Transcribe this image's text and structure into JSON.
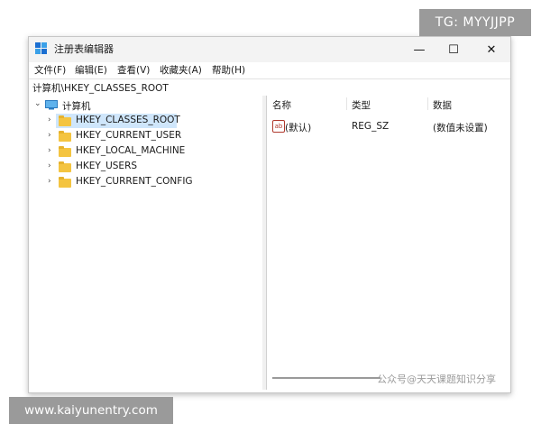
{
  "window": {
    "title": "注册表编辑器",
    "controls": {
      "minimize": "—",
      "maximize": "☐",
      "close": "✕"
    }
  },
  "menu": [
    "文件(F)",
    "编辑(E)",
    "查看(V)",
    "收藏夹(A)",
    "帮助(H)"
  ],
  "address": "计算机\\HKEY_CLASSES_ROOT",
  "tree": {
    "root": "计算机",
    "keys": [
      "HKEY_CLASSES_ROOT",
      "HKEY_CURRENT_USER",
      "HKEY_LOCAL_MACHINE",
      "HKEY_USERS",
      "HKEY_CURRENT_CONFIG"
    ],
    "selected_index": 0
  },
  "list": {
    "columns": [
      "名称",
      "类型",
      "数据"
    ],
    "rows": [
      {
        "icon": "ab-string-icon",
        "name": "(默认)",
        "type": "REG_SZ",
        "data": "(数值未设置)"
      }
    ]
  },
  "overlays": {
    "tg": "TG: MYYJJPP",
    "site": "www.kaiyunentry.com",
    "wechat": "公众号@天天课题知识分享"
  },
  "colors": {
    "selection": "#cfe6fb",
    "folder": "#f4c440",
    "badge": "#9a9a9a"
  }
}
